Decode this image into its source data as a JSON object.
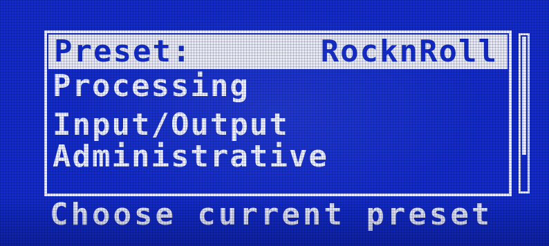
{
  "header": {
    "label": "Preset:",
    "value": "RocknRoll"
  },
  "menu": {
    "items": [
      {
        "label": "Processing"
      },
      {
        "label": "Input/Output"
      },
      {
        "label": "Administrative"
      }
    ]
  },
  "scrollbar": {
    "position": 0.0,
    "visible_fraction": 0.77
  },
  "status": {
    "text": "Choose current preset"
  },
  "colors": {
    "background": "#0f2bd6",
    "foreground": "#eef1ff",
    "highlight": "#e8ebf2"
  }
}
